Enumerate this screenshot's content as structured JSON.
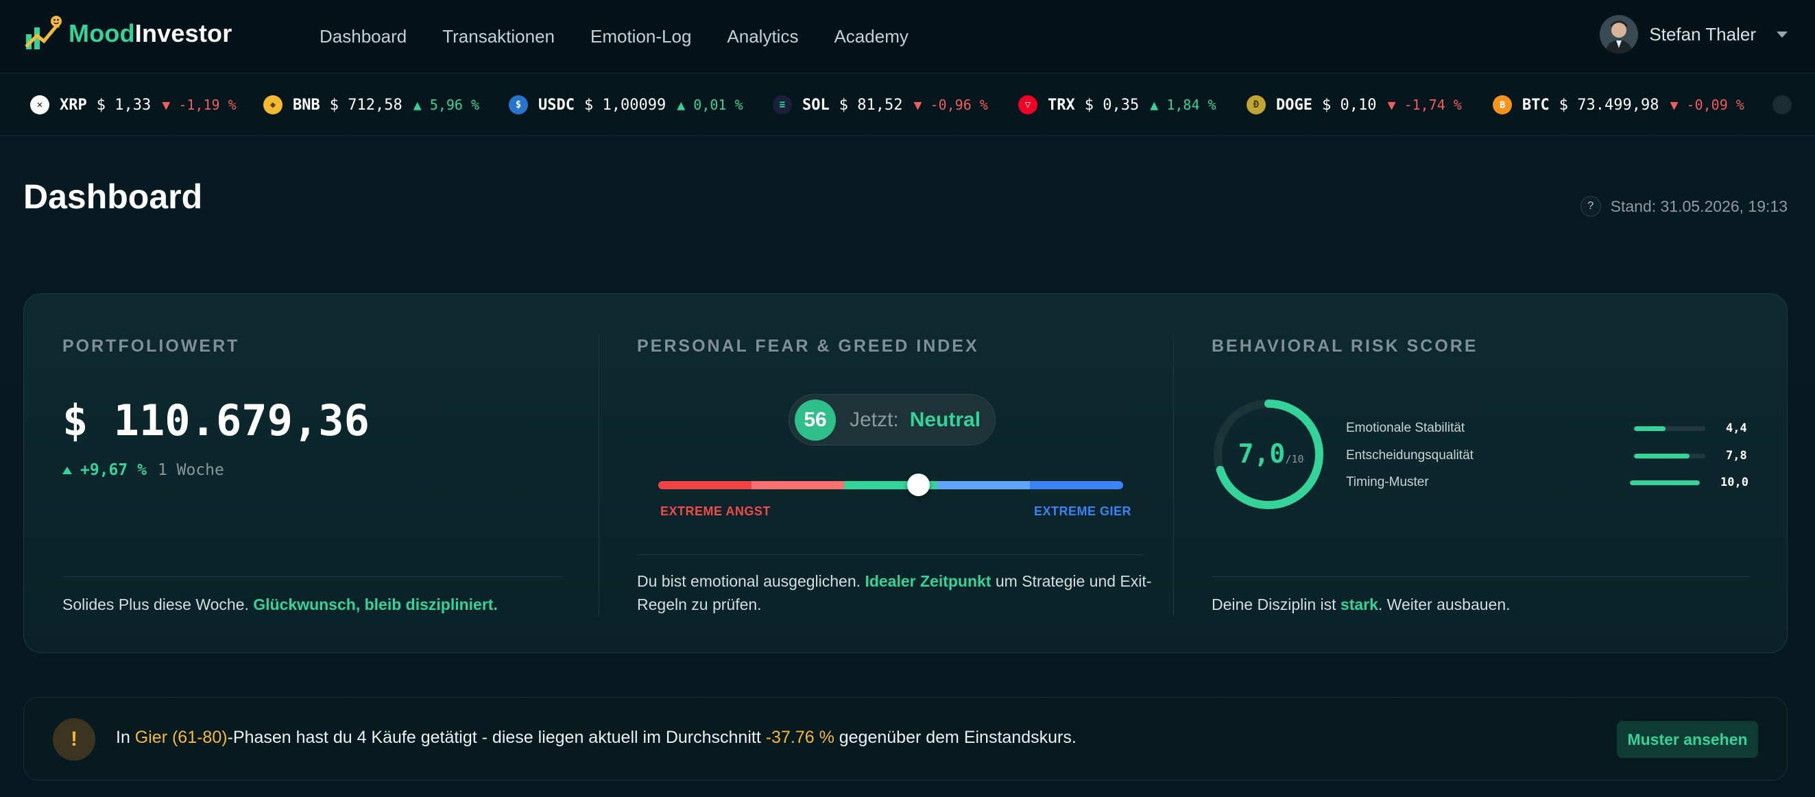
{
  "brand": {
    "part1": "Mood",
    "part2": "Investor"
  },
  "nav": {
    "items": [
      "Dashboard",
      "Transaktionen",
      "Emotion-Log",
      "Analytics",
      "Academy"
    ]
  },
  "user": {
    "name": "Stefan Thaler"
  },
  "ticker": [
    {
      "symbol": "XRP",
      "price": "$ 1,33",
      "change": "-1,19 %",
      "direction": "down",
      "icon": "xrp-icon",
      "color": "#ffffff"
    },
    {
      "symbol": "BNB",
      "price": "$ 712,58",
      "change": "5,96 %",
      "direction": "up",
      "icon": "bnb-icon",
      "color": "#f3ba2f"
    },
    {
      "symbol": "USDC",
      "price": "$ 1,00099",
      "change": "0,01 %",
      "direction": "up",
      "icon": "usdc-icon",
      "color": "#2775ca"
    },
    {
      "symbol": "SOL",
      "price": "$ 81,52",
      "change": "-0,96 %",
      "direction": "down",
      "icon": "sol-icon",
      "color": "#9945ff"
    },
    {
      "symbol": "TRX",
      "price": "$ 0,35",
      "change": "1,84 %",
      "direction": "up",
      "icon": "trx-icon",
      "color": "#ef0027"
    },
    {
      "symbol": "DOGE",
      "price": "$ 0,10",
      "change": "-1,74 %",
      "direction": "down",
      "icon": "doge-icon",
      "color": "#c2a633"
    },
    {
      "symbol": "BTC",
      "price": "$ 73.499,98",
      "change": "-0,09 %",
      "direction": "down",
      "icon": "btc-icon",
      "color": "#f7931a"
    }
  ],
  "page": {
    "title": "Dashboard",
    "stand": "Stand: 31.05.2026, 19:13",
    "help": "?"
  },
  "portfolio": {
    "label": "PORTFOLIOWERT",
    "value": "$ 110.679,36",
    "change": "+9,67 %",
    "period": "1 Woche",
    "footer_plain": "Solides Plus diese Woche.",
    "footer_highlight": "Glückwunsch, bleib diszipliniert."
  },
  "fear_greed": {
    "label": "PERSONAL FEAR & GREED INDEX",
    "value": "56",
    "value_fraction": 0.56,
    "now_label": "Jetzt:",
    "state": "Neutral",
    "left_label": "EXTREME ANGST",
    "right_label": "EXTREME GIER",
    "footer_a": "Du bist emotional ausgeglichen.",
    "footer_highlight": "Idealer Zeitpunkt",
    "footer_b": "um Strategie und Exit-Regeln zu prüfen.",
    "colors": [
      "#ef4444",
      "#f87171",
      "#34d399",
      "#60a5fa",
      "#3b82f6"
    ]
  },
  "risk": {
    "label": "BEHAVIORAL RISK SCORE",
    "score": "7,0",
    "score_suffix": "/10",
    "score_fraction": 0.7,
    "metrics": [
      {
        "label": "Emotionale Stabilität",
        "value": "4,4",
        "fraction": 0.44
      },
      {
        "label": "Entscheidungsqualität",
        "value": "7,8",
        "fraction": 0.78
      },
      {
        "label": "Timing-Muster",
        "value": "10,0",
        "fraction": 1.0
      }
    ],
    "footer_a": "Deine Disziplin ist",
    "footer_highlight": "stark",
    "footer_b": ". Weiter ausbauen."
  },
  "alert": {
    "icon": "!",
    "t1": "In ",
    "t2": "Gier (61-80)",
    "t3": "-Phasen hast du 4 Käufe getätigt - diese liegen aktuell im Durchschnitt ",
    "t4": "-37.76 %",
    "t5": " gegenüber dem Einstandskurs.",
    "button": "Muster ansehen"
  }
}
